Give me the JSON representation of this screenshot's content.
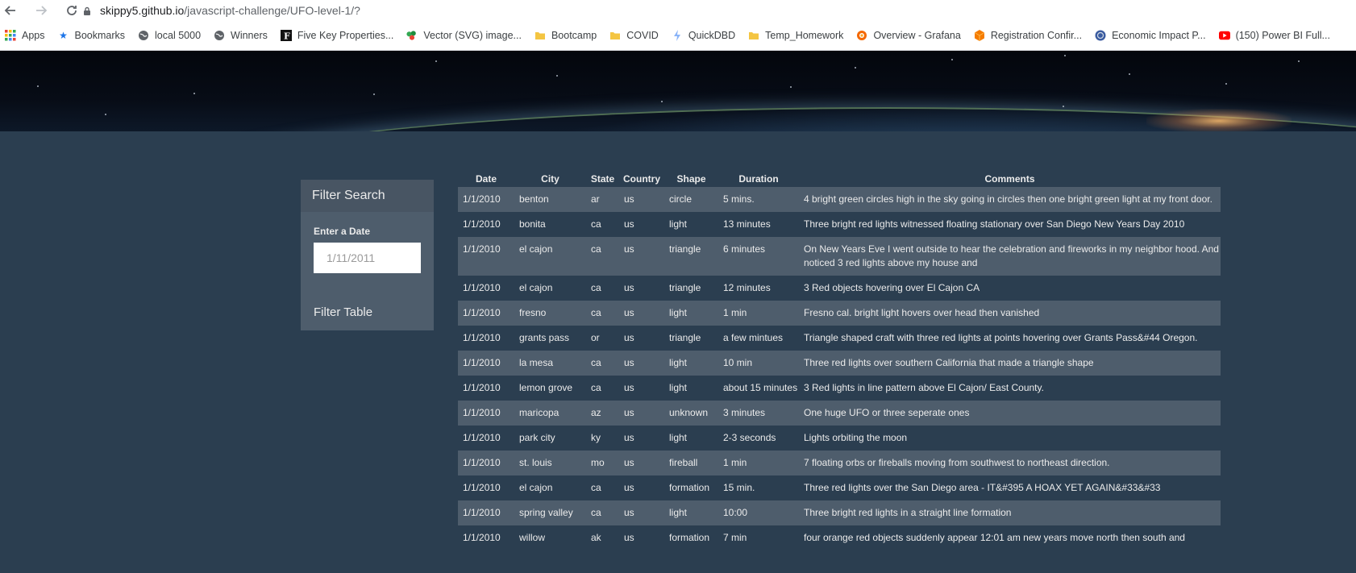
{
  "browser": {
    "url_host": "skippy5.github.io",
    "url_path": "/javascript-challenge/UFO-level-1/?",
    "bookmarks": [
      {
        "label": "Apps",
        "icon": "apps-grid-icon",
        "color": "#ea4335"
      },
      {
        "label": "Bookmarks",
        "icon": "star-icon",
        "color": "#1a73e8"
      },
      {
        "label": "local 5000",
        "icon": "globe-icon",
        "color": "#5f6368"
      },
      {
        "label": "Winners",
        "icon": "globe-icon",
        "color": "#5f6368"
      },
      {
        "label": "Five Key Properties...",
        "icon": "f-logo-icon",
        "color": "#111111"
      },
      {
        "label": "Vector (SVG) image...",
        "icon": "svg-logo-icon",
        "color": "#34a853"
      },
      {
        "label": "Bootcamp",
        "icon": "folder-icon",
        "color": "#f4c542"
      },
      {
        "label": "COVID",
        "icon": "folder-icon",
        "color": "#f4c542"
      },
      {
        "label": "QuickDBD",
        "icon": "lightning-icon",
        "color": "#5f6368"
      },
      {
        "label": "Temp_Homework",
        "icon": "folder-icon",
        "color": "#f4c542"
      },
      {
        "label": "Overview - Grafana",
        "icon": "grafana-icon",
        "color": "#f46800"
      },
      {
        "label": "Registration Confir...",
        "icon": "cube-icon",
        "color": "#f57c00"
      },
      {
        "label": "Economic Impact P...",
        "icon": "seal-icon",
        "color": "#3a5ba0"
      },
      {
        "label": "(150) Power BI Full...",
        "icon": "youtube-icon",
        "color": "#ff0000"
      }
    ]
  },
  "filter": {
    "title": "Filter Search",
    "date_label": "Enter a Date",
    "date_placeholder": "1/11/2011",
    "button_label": "Filter Table"
  },
  "table": {
    "headers": [
      "Date",
      "City",
      "State",
      "Country",
      "Shape",
      "Duration",
      "Comments"
    ],
    "rows": [
      [
        "1/1/2010",
        "benton",
        "ar",
        "us",
        "circle",
        "5 mins.",
        "4 bright green circles high in the sky going in circles then one bright green light at my front door."
      ],
      [
        "1/1/2010",
        "bonita",
        "ca",
        "us",
        "light",
        "13 minutes",
        "Three bright red lights witnessed floating stationary over San Diego New Years Day 2010"
      ],
      [
        "1/1/2010",
        "el cajon",
        "ca",
        "us",
        "triangle",
        "6 minutes",
        "On New Years Eve I went outside to hear the celebration and fireworks in my neighbor hood. And noticed 3 red lights above my house and"
      ],
      [
        "1/1/2010",
        "el cajon",
        "ca",
        "us",
        "triangle",
        "12 minutes",
        "3 Red objects hovering over El Cajon CA"
      ],
      [
        "1/1/2010",
        "fresno",
        "ca",
        "us",
        "light",
        "1 min",
        "Fresno cal. bright light hovers over head then vanished"
      ],
      [
        "1/1/2010",
        "grants pass",
        "or",
        "us",
        "triangle",
        "a few mintues",
        "Triangle shaped craft with three red lights at points hovering over Grants Pass&#44 Oregon."
      ],
      [
        "1/1/2010",
        "la mesa",
        "ca",
        "us",
        "light",
        "10 min",
        "Three red lights over southern California that made a triangle shape"
      ],
      [
        "1/1/2010",
        "lemon grove",
        "ca",
        "us",
        "light",
        "about 15 minutes",
        "3 Red lights in line pattern above El Cajon/ East County."
      ],
      [
        "1/1/2010",
        "maricopa",
        "az",
        "us",
        "unknown",
        "3 minutes",
        "One huge UFO or three seperate ones"
      ],
      [
        "1/1/2010",
        "park city",
        "ky",
        "us",
        "light",
        "2-3 seconds",
        "Lights orbiting the moon"
      ],
      [
        "1/1/2010",
        "st. louis",
        "mo",
        "us",
        "fireball",
        "1 min",
        "7 floating orbs or fireballs moving from southwest to northeast direction."
      ],
      [
        "1/1/2010",
        "el cajon",
        "ca",
        "us",
        "formation",
        "15 min.",
        "Three red lights over the San Diego area - IT&#395 A HOAX YET AGAIN&#33&#33"
      ],
      [
        "1/1/2010",
        "spring valley",
        "ca",
        "us",
        "light",
        "10:00",
        "Three bright red lights in a straight line formation"
      ],
      [
        "1/1/2010",
        "willow",
        "ak",
        "us",
        "formation",
        "7 min",
        "four orange red objects suddenly appear 12:01 am new years move north then south and"
      ]
    ]
  }
}
